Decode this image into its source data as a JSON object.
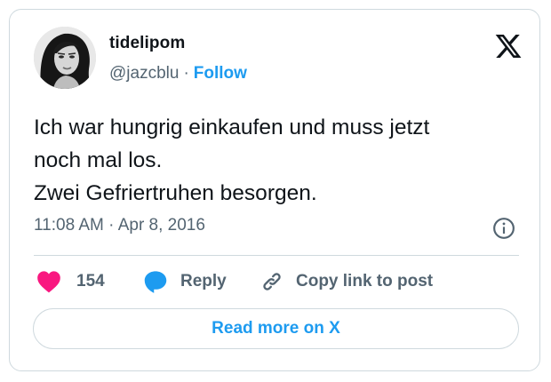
{
  "author": {
    "display_name": "tidelipom",
    "handle": "@jazcblu",
    "separator": "·",
    "follow_label": "Follow",
    "avatar": "profile-photo"
  },
  "brand_icon": "x-logo-icon",
  "tweet": {
    "text": "Ich war hungrig einkaufen und muss jetzt\nnoch mal los.\nZwei Gefriertruhen besorgen.",
    "timestamp": "11:08 AM · Apr 8, 2016"
  },
  "actions": {
    "like_count": "154",
    "reply_label": "Reply",
    "copy_label": "Copy link to post"
  },
  "read_more_label": "Read more on X",
  "colors": {
    "accent": "#1d9bf0",
    "like": "#f91880",
    "text": "#0f1419",
    "secondary_text": "#536471",
    "border": "#cfd9de"
  }
}
